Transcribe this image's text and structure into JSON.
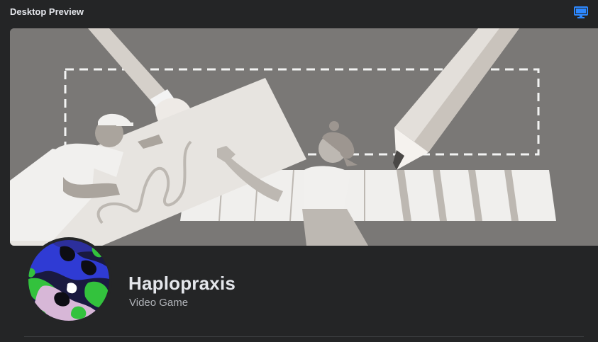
{
  "header": {
    "title": "Desktop Preview",
    "preview_icon": "desktop-monitor-icon"
  },
  "cover": {
    "illustration": "cover-illustration"
  },
  "profile": {
    "avatar_icon": "profile-avatar",
    "name": "Haplopraxis",
    "category": "Video Game"
  },
  "colors": {
    "background": "#242526",
    "text_primary": "#e4e6eb",
    "text_secondary": "#b0b3b8",
    "accent": "#2d88ff",
    "cover_bg": "#7a7876"
  }
}
